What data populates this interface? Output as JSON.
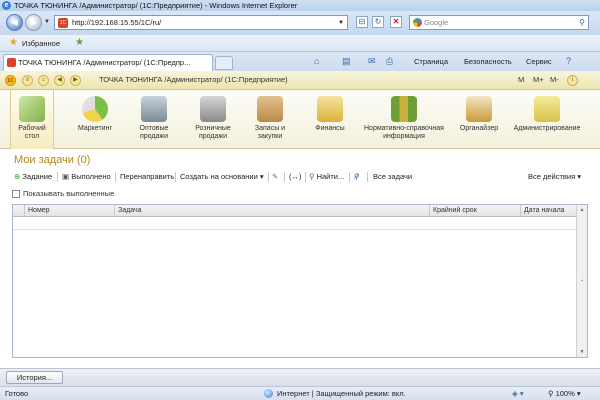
{
  "window": {
    "title": "ТОЧКА ТЮНИНГА /Администратор/ (1С:Предприятие) - Windows Internet Explorer",
    "ie_logo": "e"
  },
  "address_bar": {
    "url": "http://192.168.15.55/1C/ru/",
    "search_placeholder": "Google",
    "page_icon": "1С"
  },
  "favorites": {
    "label": "Избранное"
  },
  "tab": {
    "title": "ТОЧКА ТЮНИНГА /Администратор/ (1С:Предпр..."
  },
  "ie_commands": {
    "page": "Страница",
    "safety": "Безопасность",
    "tools": "Сервис"
  },
  "app_header": {
    "title": "ТОЧКА ТЮНИНГА /Администратор/ (1С:Предприятие)",
    "logo": "1С",
    "m": "M",
    "m_plus": "M+",
    "m_minus": "M-"
  },
  "sections": [
    {
      "label1": "Рабочий",
      "label2": "стол",
      "icon": "desktop-icon",
      "color": "#7fb14a"
    },
    {
      "label1": "Маркетинг",
      "label2": "",
      "icon": "marketing-icon",
      "color": "#7cc04a"
    },
    {
      "label1": "Оптовые",
      "label2": "продажи",
      "icon": "truck-icon",
      "color": "#7a8a95"
    },
    {
      "label1": "Розничные",
      "label2": "продажи",
      "icon": "cash-register-icon",
      "color": "#8a8a8a"
    },
    {
      "label1": "Запасы и",
      "label2": "закупки",
      "icon": "boxes-icon",
      "color": "#b98a4a"
    },
    {
      "label1": "Финансы",
      "label2": "",
      "icon": "coins-icon",
      "color": "#d9b23a"
    },
    {
      "label1": "Нормативно-справочная",
      "label2": "информация",
      "icon": "books-icon",
      "color": "#6fa038"
    },
    {
      "label1": "Органайзер",
      "label2": "",
      "icon": "clipboard-icon",
      "color": "#c99a3a"
    },
    {
      "label1": "Администрирование",
      "label2": "",
      "icon": "database-icon",
      "color": "#d8c24a"
    }
  ],
  "main": {
    "page_title": "Мои задачи (0)",
    "toolbar": {
      "task": "Задание",
      "done": "Выполнено",
      "forward": "Перенаправить",
      "create_based": "Создать на основании",
      "find": "Найти...",
      "all_tasks": "Все задачи",
      "all_actions": "Все действия"
    },
    "show_completed_label": "Показывать выполненные",
    "show_completed_checked": false,
    "columns": [
      "Номер",
      "Задача",
      "Крайний срок",
      "Дата начала"
    ],
    "rows": []
  },
  "history_button": "История...",
  "status": {
    "done": "Готово",
    "zone": "Интернет | Защищенный режим: вкл.",
    "zoom": "100%"
  }
}
